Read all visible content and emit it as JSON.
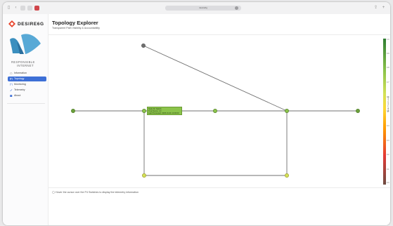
{
  "browser": {
    "url_text": "desire6g"
  },
  "sidebar": {
    "brand": "DESIRE6G",
    "partner_logo_line1": "RESPONSIBLE",
    "partner_logo_line2": "INTERNET",
    "items": [
      {
        "label": "Information",
        "icon": "info-icon",
        "active": false
      },
      {
        "label": "Topology",
        "icon": "topology-icon",
        "active": true
      },
      {
        "label": "Monitoring",
        "icon": "chart-icon",
        "active": false
      },
      {
        "label": "Telemetry",
        "icon": "telemetry-icon",
        "active": false
      },
      {
        "label": "About",
        "icon": "about-icon",
        "active": false
      }
    ]
  },
  "main": {
    "title": "Topology Explorer",
    "subtitle": "Transparent Path Visibility & Accountability",
    "tooltip": {
      "line1": "Node ID: Switch",
      "line2": "Trust Score: 1.0",
      "line3": "Last Processed: 2025-01-01 12:00:00"
    },
    "legend": {
      "label": "Node Trust Level",
      "ticks": [
        "1.0",
        "0.9",
        "0.8",
        "0.7",
        "0.6",
        "0.5",
        "0.4",
        "0.3",
        "0.2",
        "0.1",
        "0.0"
      ]
    },
    "hint": "Hover the cursor over the P4 Switches to display the telemetry information"
  },
  "colors": {
    "accent": "#3d6fd6",
    "node_green": "#8bc34a",
    "node_dark": "#5a8f2c",
    "node_yellow": "#d4e157",
    "node_gray": "#707070",
    "edge": "#707070"
  }
}
